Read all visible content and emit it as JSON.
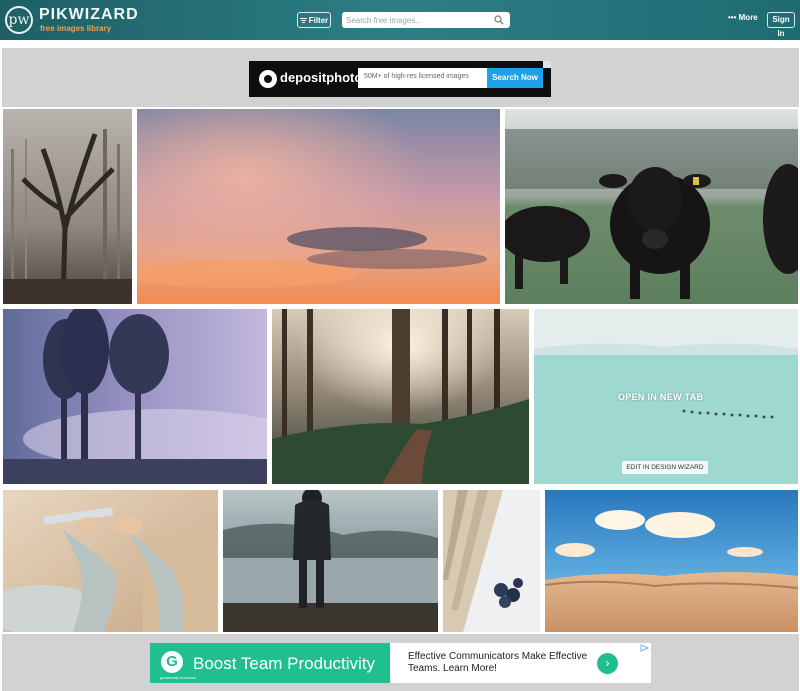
{
  "header": {
    "logo_mark": "pw",
    "logo_name": "PIKWIZARD",
    "logo_tagline": "free images library",
    "filter_label": "Filter",
    "search_placeholder": "Search free images...",
    "more_label": "More",
    "signin_label": "Sign In",
    "colors": {
      "bar": "#2c7f86",
      "tagline": "#f2a04a"
    }
  },
  "ads": {
    "top": {
      "brand": "depositphotos",
      "text": "50M+ of high-res licensed images",
      "button": "Search Now",
      "button_color": "#1ea1e8"
    },
    "bottom": {
      "logo_letter": "G",
      "logo_sub": "grammarly business",
      "headline": "Boost Team Productivity",
      "body": "Effective Communicators Make Effective Teams. Learn More!",
      "arrow": "›",
      "accent": "#1fbf8f"
    }
  },
  "gallery": {
    "photos": [
      {
        "name": "foggy-forest-photo"
      },
      {
        "name": "pink-sunset-sky-photo"
      },
      {
        "name": "black-cows-photo"
      },
      {
        "name": "purple-misty-trees-photo"
      },
      {
        "name": "sunlit-forest-path-photo"
      },
      {
        "name": "snowy-hikers-photo",
        "hover_label": "OPEN IN NEW TAB",
        "edit_label": "EDIT IN DESIGN WIZARD"
      },
      {
        "name": "woman-with-tablet-photo"
      },
      {
        "name": "man-by-misty-lake-photo"
      },
      {
        "name": "people-aerial-photo"
      },
      {
        "name": "sand-dunes-photo"
      }
    ]
  }
}
